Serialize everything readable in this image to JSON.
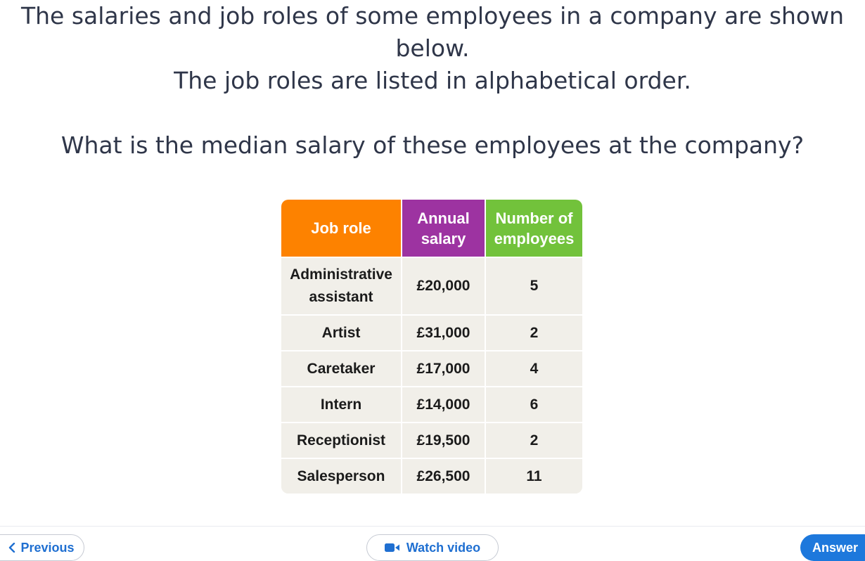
{
  "question": {
    "line1": "The salaries and job roles of some employees in a company are shown",
    "line2": "below.",
    "line3": "The job roles are listed in alphabetical order.",
    "line4": "What is the median salary of these employees at the company?"
  },
  "table": {
    "headers": {
      "job_role": "Job role",
      "salary_line1": "Annual",
      "salary_line2": "salary",
      "employees_line1": "Number of",
      "employees_line2": "employees"
    },
    "header_colors": {
      "job_role": "#fd8200",
      "salary": "#9d33a1",
      "employees": "#72c23b"
    },
    "rows": [
      {
        "role_line1": "Administrative",
        "role_line2": "assistant",
        "salary": "£20,000",
        "count": "5"
      },
      {
        "role_line1": "Artist",
        "salary": "£31,000",
        "count": "2"
      },
      {
        "role_line1": "Caretaker",
        "salary": "£17,000",
        "count": "4"
      },
      {
        "role_line1": "Intern",
        "salary": "£14,000",
        "count": "6"
      },
      {
        "role_line1": "Receptionist",
        "salary": "£19,500",
        "count": "2"
      },
      {
        "role_line1": "Salesperson",
        "salary": "£26,500",
        "count": "11"
      }
    ]
  },
  "footer": {
    "previous_label": "Previous",
    "previous_icon": "chevron-left-icon",
    "video_label": "Watch video",
    "video_icon": "video-camera-icon",
    "answer_label": "Answer"
  },
  "colors": {
    "accent": "#1d78dc",
    "link": "#1f6fd1"
  }
}
